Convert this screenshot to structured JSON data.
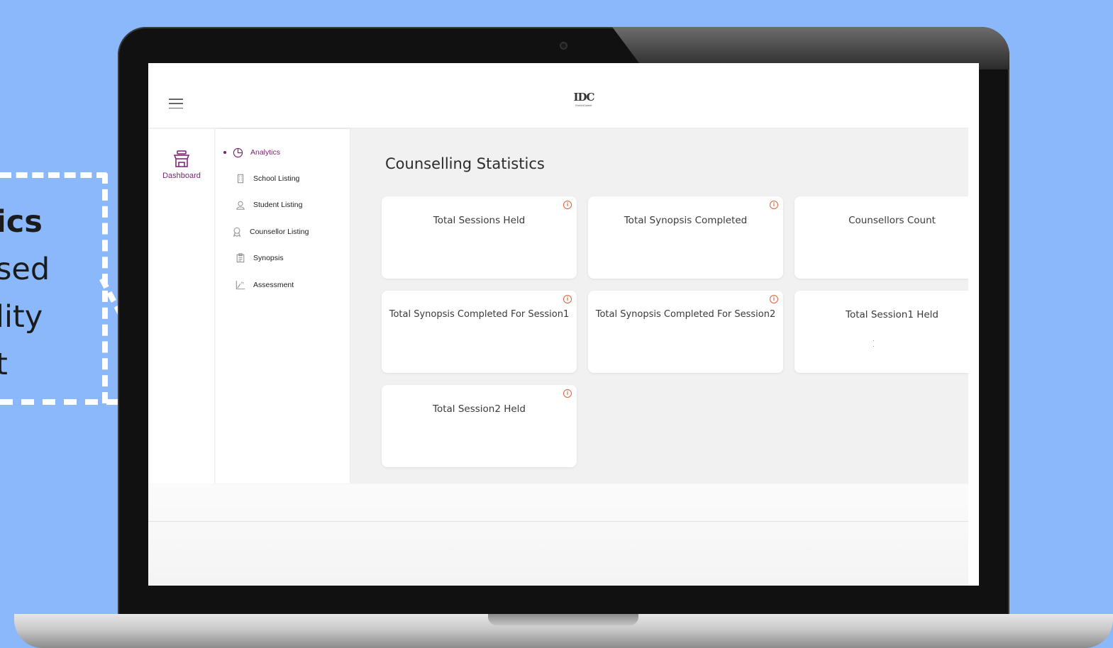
{
  "callout": {
    "lines": [
      "ics",
      "sed",
      "lity",
      "t"
    ]
  },
  "app": {
    "logo_text": "IDC",
    "logo_sub": "EnrichCareer"
  },
  "rail": {
    "items": [
      {
        "label": "Dashboard",
        "icon": "store-icon"
      }
    ]
  },
  "submenu": {
    "items": [
      {
        "label": "Analytics",
        "icon": "pie-chart-icon",
        "active": true
      },
      {
        "label": "School Listing",
        "icon": "building-icon"
      },
      {
        "label": "Student Listing",
        "icon": "user-icon"
      },
      {
        "label": "Counsellor Listing",
        "icon": "award-icon"
      },
      {
        "label": "Synopsis",
        "icon": "clipboard-icon"
      },
      {
        "label": "Assessment",
        "icon": "function-chart-icon"
      }
    ]
  },
  "main": {
    "title": "Counselling Statistics",
    "cards": [
      {
        "title": "Total Sessions Held",
        "info": true
      },
      {
        "title": "Total Synopsis Completed",
        "info": true
      },
      {
        "title": "Counsellors Count",
        "info": false
      },
      {
        "title": "Total Synopsis Completed For Session1",
        "info": true
      },
      {
        "title": "Total Synopsis Completed For Session2",
        "info": true
      },
      {
        "title": "Total Session1 Held",
        "info": false,
        "loading": true
      },
      {
        "title": "Total Session2 Held",
        "info": true
      }
    ]
  },
  "colors": {
    "background": "#8ab8fb",
    "accent": "#7a1f6f",
    "info": "#e0623a"
  }
}
